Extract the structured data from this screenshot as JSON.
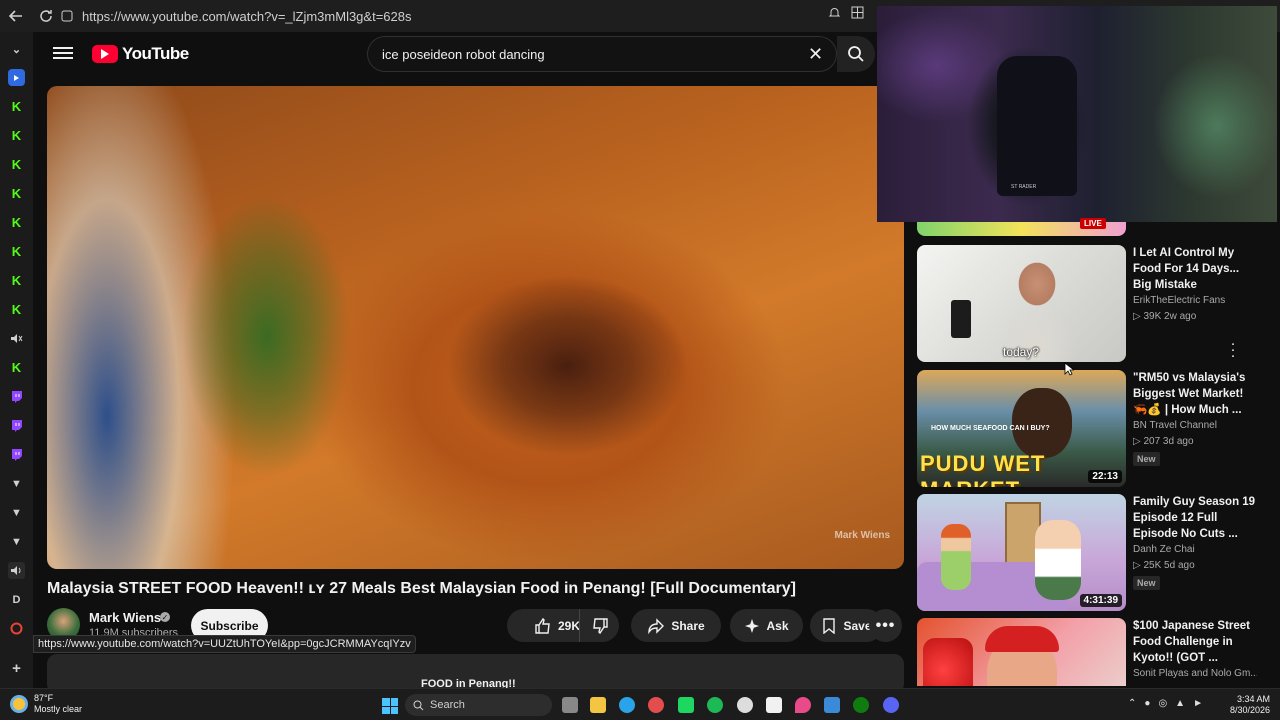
{
  "browser": {
    "url": "https://www.youtube.com/watch?v=_lZjm3mMl3g&t=628s"
  },
  "youtube": {
    "logo_text": "YouTube",
    "search_value": "ice poseideon robot dancing",
    "video": {
      "watermark": "Mark Wiens",
      "title": "Malaysia STREET FOOD Heaven!! ʟʏ 27 Meals Best Malaysian Food in Penang! [Full Documentary]",
      "channel": "Mark Wiens",
      "subscribers": "11.9M subscribers",
      "subscribe_label": "Subscribe",
      "likes": "29K",
      "share_label": "Share",
      "ask_label": "Ask",
      "save_label": "Save",
      "description_peek": "FOOD in Penang!!"
    },
    "hover_url": "https://www.youtube.com/watch?v=UUZtUhTOYeI&pp=0gcJCRMMAYcqIYzv"
  },
  "recommendations": {
    "live_badge": "LIVE",
    "items": [
      {
        "title": "I Let AI Control My Food For 14 Days... Big Mistake",
        "channel": "ErikTheElectric Fans",
        "stats": "▷ 39K  2w ago",
        "thumb_caption": "today?"
      },
      {
        "title": "\"RM50 vs Malaysia's Biggest Wet Market! 🦐💰 | How Much ...",
        "channel": "BN Travel Channel",
        "stats": "▷ 207  3d ago",
        "badge": "New",
        "duration": "22:13",
        "thumb_big": "PUDU WET MARKET",
        "thumb_small": "HOW MUCH SEAFOOD CAN I BUY?"
      },
      {
        "title": "Family Guy Season 19 Episode 12 Full Episode No Cuts ...",
        "channel": "Danh Ze Chai",
        "stats": "▷ 25K  5d ago",
        "badge": "New",
        "duration": "4:31:39"
      },
      {
        "title": "$100 Japanese Street Food Challenge in Kyoto!! (GOT ...",
        "channel": "Sonit Playas and Nolo Gm..."
      }
    ]
  },
  "stream": {
    "chair_text": "ST RADER"
  },
  "taskbar": {
    "temperature": "87°F",
    "weather": "Mostly clear",
    "search_label": "Search",
    "time": "3:34 AM",
    "date": "8/30/2026"
  },
  "colors": {
    "accent": "#ff0033",
    "kick": "#53fc18",
    "twitch": "#9146ff",
    "bg": "#0f0f0f"
  }
}
